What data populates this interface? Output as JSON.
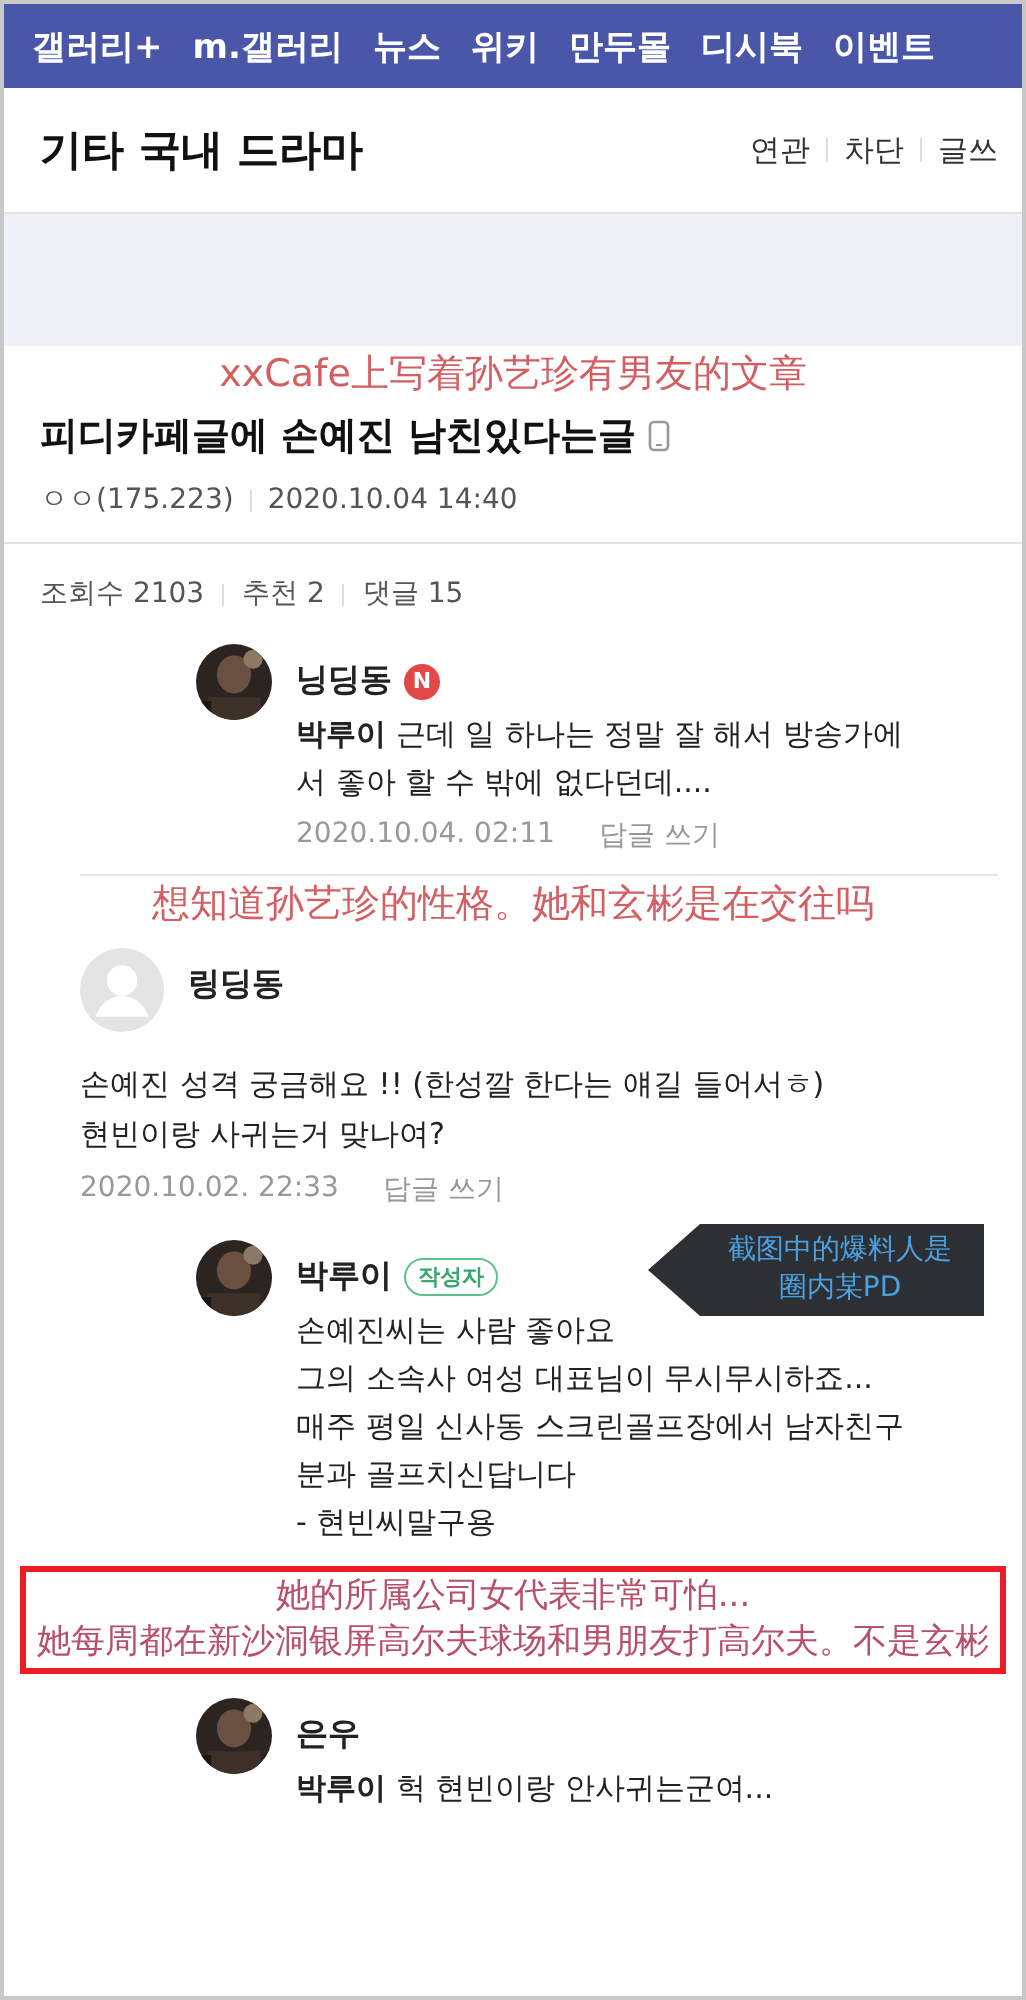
{
  "nav": {
    "items": [
      "갤러리+",
      "m.갤러리",
      "뉴스",
      "위키",
      "만두몰",
      "디시북",
      "이벤트"
    ]
  },
  "board": {
    "title": "기타 국내 드라마",
    "actions": [
      "연관",
      "차단",
      "글쓰"
    ]
  },
  "post": {
    "title": "피디카페글에 손예진 남친있다는글",
    "author": "ㅇㅇ(175.223)",
    "date": "2020.10.04 14:40",
    "stats": [
      {
        "label": "조회수",
        "value": "2103"
      },
      {
        "label": "추천",
        "value": "2"
      },
      {
        "label": "댓글",
        "value": "15"
      }
    ]
  },
  "comments": [
    {
      "kind": "reply",
      "author": "닝딩동",
      "badge": "N",
      "text": "**박루이**  근데 일 하나는 정말 잘 해서 방송가에서 좋아 할 수 밖에 없다던데....",
      "date": "2020.10.04. 02:11",
      "action": "답글 쓰기"
    },
    {
      "kind": "top",
      "avatar": {
        "kind": "default"
      },
      "author": "링딩동",
      "text": "손예진 성격 궁금해요 !! (한성깔 한다는 얘길 들어서ㅎ)\n현빈이랑 사귀는거 맞나여?",
      "date": "2020.10.02. 22:33",
      "action": "답글 쓰기"
    },
    {
      "kind": "reply",
      "author": "박루이",
      "badge": "작성자",
      "text": "손예진씨는 사람 좋아요\n그의 소속사 여성 대표님이 무시무시하죠... 매주 평일 신사동 스크린골프장에서 남자친구분과 골프치신답니다\n- 현빈씨말구용"
    },
    {
      "kind": "reply",
      "author": "은우",
      "text": "**박루이**  헉 현빈이랑 안사귀는군여..."
    }
  ],
  "annotations": [
    {
      "kind": "caption",
      "text": "xxCafe上写着孙艺珍有男友的文章"
    },
    {
      "kind": "caption",
      "text": "想知道孙艺珍的性格。她和玄彬是在交往吗"
    },
    {
      "kind": "callout",
      "text": "截图中的爆料人是圈内某PD"
    },
    {
      "kind": "boxed",
      "text": "她的所属公司女代表非常可怕...\n她每周都在新沙洞银屏高尔夫球场和男朋友打高尔夫。不是玄彬"
    }
  ]
}
